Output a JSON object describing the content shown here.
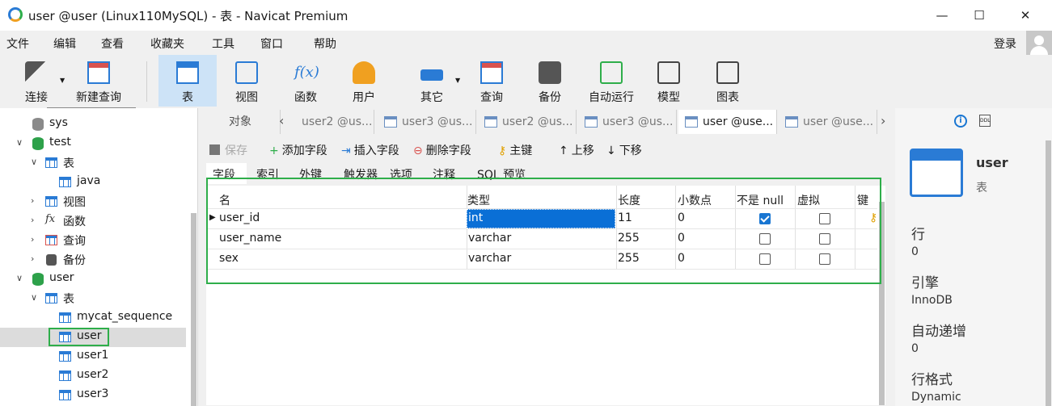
{
  "window": {
    "title": "user @user (Linux110MySQL) - 表 - Navicat Premium",
    "minimize": "—",
    "maximize": "☐",
    "close": "✕"
  },
  "menu": [
    "文件",
    "编辑",
    "查看",
    "收藏夹",
    "工具",
    "窗口",
    "帮助"
  ],
  "login": "登录",
  "toolbar": [
    "连接",
    "新建查询",
    "表",
    "视图",
    "函数",
    "用户",
    "其它",
    "查询",
    "备份",
    "自动运行",
    "模型",
    "图表"
  ],
  "tree": {
    "sys": "sys",
    "test": "test",
    "test_tables": "表",
    "java": "java",
    "views": "视图",
    "functions": "函数",
    "queries": "查询",
    "backups": "备份",
    "user_db": "user",
    "user_tables": "表",
    "tables": [
      "mycat_sequence",
      "user",
      "user1",
      "user2",
      "user3"
    ]
  },
  "tabs": {
    "objects": "对象",
    "items": [
      "user2 @us...",
      "user3 @us...",
      "user2 @us...",
      "user3 @us...",
      "user @use...",
      "user @use..."
    ]
  },
  "subtoolbar": {
    "save": "保存",
    "add_field": "添加字段",
    "insert_field": "插入字段",
    "delete_field": "删除字段",
    "primary_key": "主键",
    "move_up": "上移",
    "move_down": "下移"
  },
  "subtabs": [
    "字段",
    "索引",
    "外键",
    "触发器",
    "选项",
    "注释",
    "SQL 预览"
  ],
  "grid": {
    "headers": [
      "名",
      "类型",
      "长度",
      "小数点",
      "不是 null",
      "虚拟",
      "键"
    ],
    "rows": [
      {
        "name": "user_id",
        "type": "int",
        "length": "11",
        "decimals": "0",
        "not_null": true,
        "virtual": false
      },
      {
        "name": "user_name",
        "type": "varchar",
        "length": "255",
        "decimals": "0",
        "not_null": false,
        "virtual": false
      },
      {
        "name": "sex",
        "type": "varchar",
        "length": "255",
        "decimals": "0",
        "not_null": false,
        "virtual": false
      }
    ]
  },
  "info": {
    "name": "user",
    "kind": "表",
    "rows_label": "行",
    "rows_value": "0",
    "engine_label": "引擎",
    "engine_value": "InnoDB",
    "autoinc_label": "自动递增",
    "autoinc_value": "0",
    "rowformat_label": "行格式",
    "rowformat_value": "Dynamic"
  },
  "colors": {
    "accent": "#2a7bd5",
    "highlight": "#2eae4a",
    "selected": "#0a6fd6"
  }
}
